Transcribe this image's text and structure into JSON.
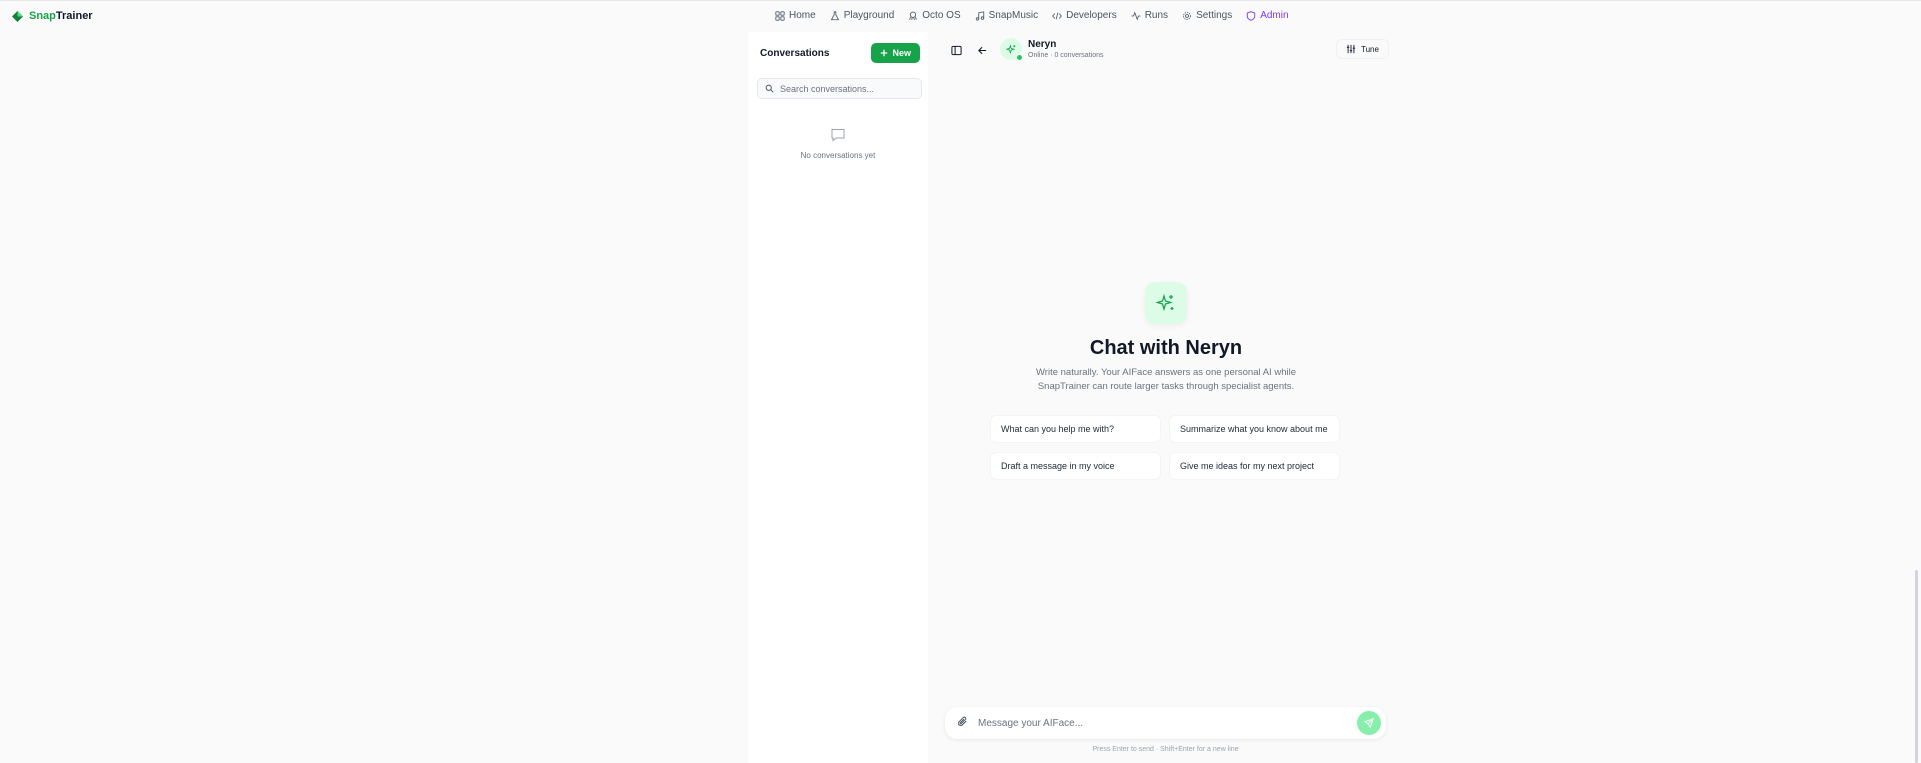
{
  "brand": {
    "part1": "Snap",
    "part2": "Trainer"
  },
  "nav": [
    {
      "label": "Home",
      "icon": "grid-icon"
    },
    {
      "label": "Playground",
      "icon": "flask-icon"
    },
    {
      "label": "Octo OS",
      "icon": "octopus-icon"
    },
    {
      "label": "SnapMusic",
      "icon": "music-icon"
    },
    {
      "label": "Developers",
      "icon": "code-icon"
    },
    {
      "label": "Runs",
      "icon": "activity-icon"
    },
    {
      "label": "Settings",
      "icon": "gear-icon"
    },
    {
      "label": "Admin",
      "icon": "shield-icon"
    }
  ],
  "conversations": {
    "title": "Conversations",
    "new_label": "New",
    "search_placeholder": "Search conversations...",
    "empty_text": "No conversations yet"
  },
  "agent": {
    "name": "Neryn",
    "status": "Online · 0 conversations",
    "tune_label": "Tune"
  },
  "hero": {
    "title": "Chat with Neryn",
    "line1": "Write naturally. Your AIFace answers as one personal AI while",
    "line2": "SnapTrainer can route larger tasks through specialist agents."
  },
  "suggestions": [
    "What can you help me with?",
    "Summarize what you know about me",
    "Draft a message in my voice",
    "Give me ideas for my next project"
  ],
  "composer": {
    "placeholder": "Message your AIFace...",
    "hint": "Press Enter to send · Shift+Enter for a new line"
  },
  "colors": {
    "accent": "#16a34a",
    "admin": "#7c3aed",
    "online": "#22c55e"
  }
}
